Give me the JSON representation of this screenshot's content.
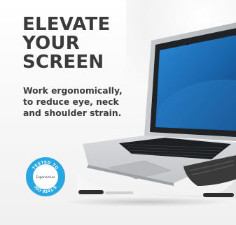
{
  "headline": {
    "line1": "ELEVATE",
    "line2": "YOUR",
    "line3": "SCREEN"
  },
  "subtext": {
    "line1": "Work ergonomically,",
    "line2": "to reduce eye, neck",
    "line3": "and shoulder strain."
  },
  "badge": {
    "top_text": "TESTED TO",
    "center_text": "Ergonomics",
    "bottom_text": "ISO 9241-5",
    "ring_color": "#2aa7e0"
  },
  "colors": {
    "headline": "#3b3b3b",
    "screen": "#1f6fb6",
    "stand": "#f2f2f2",
    "stand_dark": "#3a3a3a"
  }
}
